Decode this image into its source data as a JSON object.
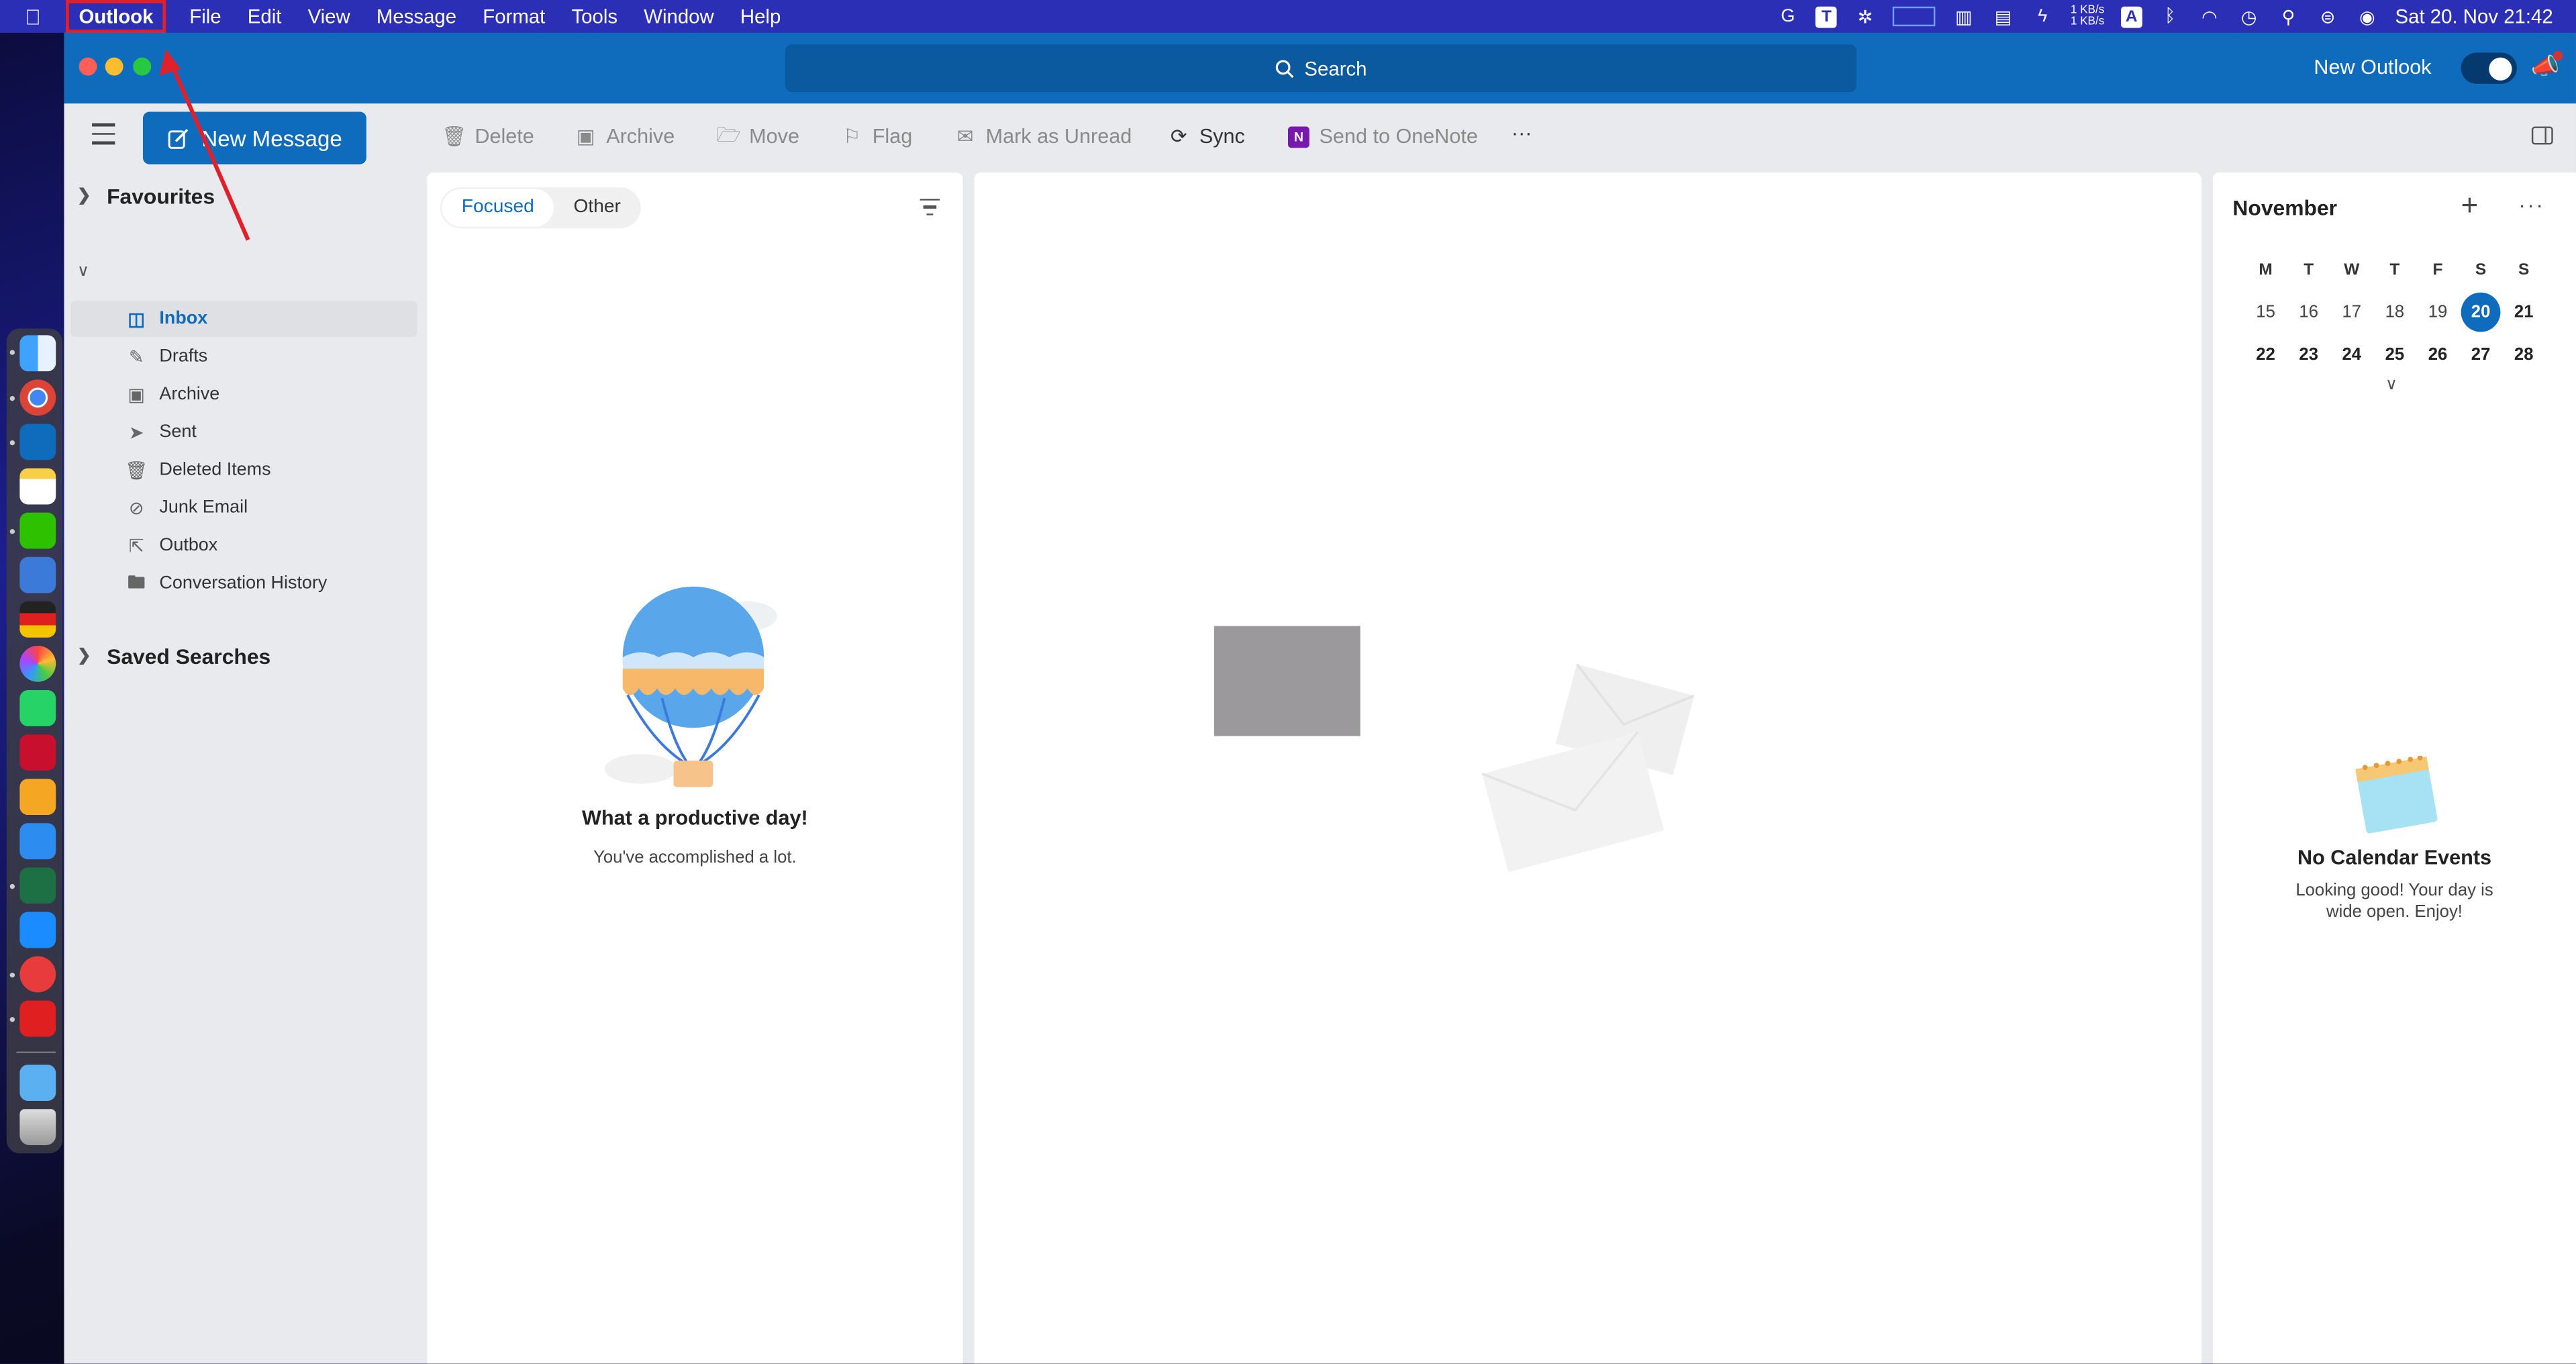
{
  "menubar": {
    "app_name": "Outlook",
    "items": [
      "File",
      "Edit",
      "View",
      "Message",
      "Format",
      "Tools",
      "Window",
      "Help"
    ],
    "net_up": "1 KB/s",
    "net_down": "1 KB/s",
    "datetime": "Sat 20. Nov  21:42",
    "keyboard_badge": "A",
    "text_badge": "T"
  },
  "titlebar": {
    "search_label": "Search",
    "new_outlook_label": "New Outlook"
  },
  "toolbar": {
    "new_message": "New Message",
    "delete": "Delete",
    "archive": "Archive",
    "move": "Move",
    "flag": "Flag",
    "mark_unread": "Mark as Unread",
    "sync": "Sync",
    "send_onenote": "Send to OneNote",
    "more": "···"
  },
  "folders": {
    "favourites": "Favourites",
    "saved_searches": "Saved Searches",
    "items": [
      {
        "label": "Inbox",
        "icon": "inbox-icon"
      },
      {
        "label": "Drafts",
        "icon": "pencil-icon"
      },
      {
        "label": "Archive",
        "icon": "archive-icon"
      },
      {
        "label": "Sent",
        "icon": "send-icon"
      },
      {
        "label": "Deleted Items",
        "icon": "trash-icon"
      },
      {
        "label": "Junk Email",
        "icon": "junk-icon"
      },
      {
        "label": "Outbox",
        "icon": "outbox-icon"
      },
      {
        "label": "Conversation History",
        "icon": "folder-icon"
      }
    ]
  },
  "message_list": {
    "tabs": [
      "Focused",
      "Other"
    ],
    "empty_title": "What a productive day!",
    "empty_subtitle": "You've accomplished a lot."
  },
  "calendar": {
    "month": "November",
    "weekday_headers": [
      "M",
      "T",
      "W",
      "T",
      "F",
      "S",
      "S"
    ],
    "weeks": [
      [
        "15",
        "16",
        "17",
        "18",
        "19",
        "20",
        "21"
      ],
      [
        "22",
        "23",
        "24",
        "25",
        "26",
        "27",
        "28"
      ]
    ],
    "today": "20",
    "no_events_title": "No Calendar Events",
    "no_events_subtitle": "Looking good! Your day is wide open. Enjoy!"
  },
  "colors": {
    "accent": "#0f6cbd",
    "menubar": "#2a2fb6",
    "annotation": "#e0202a"
  }
}
